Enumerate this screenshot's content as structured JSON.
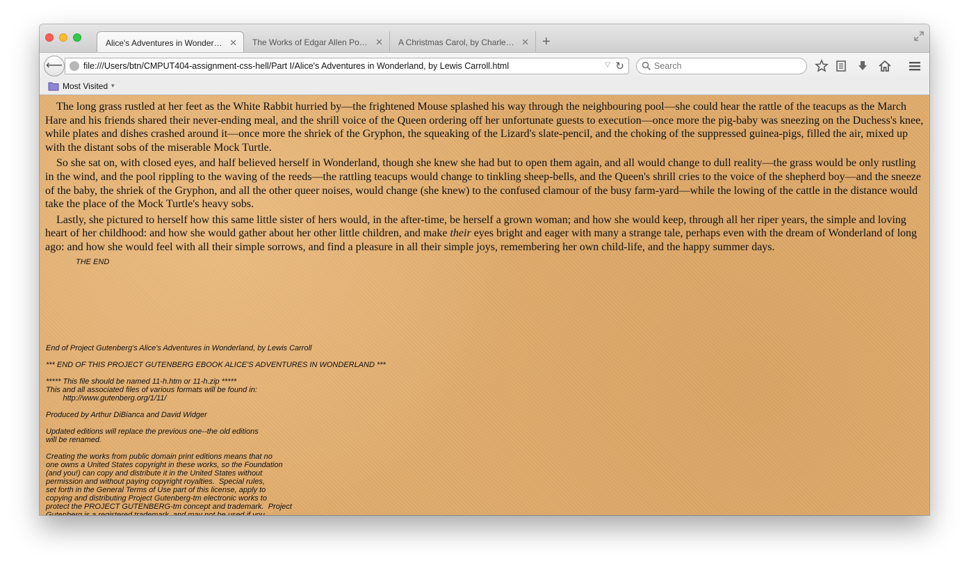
{
  "tabs": [
    {
      "title": "Alice's Adventures in Wonderl…",
      "active": true
    },
    {
      "title": "The Works of Edgar Allen Poe,…",
      "active": false
    },
    {
      "title": "A Christmas Carol, by Charles …",
      "active": false
    }
  ],
  "tab_close_glyph": "✕",
  "new_tab_glyph": "+",
  "navbar": {
    "back_glyph": "⟵",
    "url": "file:///Users/btn/CMPUT404-assignment-css-hell/Part I/Alice's Adventures in Wonderland, by Lewis Carroll.html",
    "dropdown_glyph": "▽",
    "reload_glyph": "↻",
    "search_placeholder": "Search"
  },
  "bookmarks": {
    "most_visited": "Most Visited",
    "arrow_glyph": "▾"
  },
  "content": {
    "paragraphs": [
      "The long grass rustled at her feet as the White Rabbit hurried by—the frightened Mouse splashed his way through the neighbouring pool—she could hear the rattle of the teacups as the March Hare and his friends shared their never-ending meal, and the shrill voice of the Queen ordering off her unfortunate guests to execution—once more the pig-baby was sneezing on the Duchess's knee, while plates and dishes crashed around it—once more the shriek of the Gryphon, the squeaking of the Lizard's slate-pencil, and the choking of the suppressed guinea-pigs, filled the air, mixed up with the distant sobs of the miserable Mock Turtle.",
      "So she sat on, with closed eyes, and half believed herself in Wonderland, though she knew she had but to open them again, and all would change to dull reality—the grass would be only rustling in the wind, and the pool rippling to the waving of the reeds—the rattling teacups would change to tinkling sheep-bells, and the Queen's shrill cries to the voice of the shepherd boy—and the sneeze of the baby, the shriek of the Gryphon, and all the other queer noises, would change (she knew) to the confused clamour of the busy farm-yard—while the lowing of the cattle in the distance would take the place of the Mock Turtle's heavy sobs."
    ],
    "p3_before": "Lastly, she pictured to herself how this same little sister of hers would, in the after-time, be herself a grown woman; and how she would keep, through all her riper years, the simple and loving heart of her childhood: and how she would gather about her other little children, and make ",
    "p3_italic": "their",
    "p3_after": " eyes bright and eager with many a strange tale, perhaps even with the dream of Wonderland of long ago: and how she would feel with all their simple sorrows, and find a pleasure in all their simple joys, remembering her own child-life, and the happy summer days.",
    "the_end": "THE END",
    "pg_lines": [
      "End of Project Gutenberg's Alice's Adventures in Wonderland, by Lewis Carroll",
      "",
      "*** END OF THIS PROJECT GUTENBERG EBOOK ALICE'S ADVENTURES IN WONDERLAND ***",
      "",
      "***** This file should be named 11-h.htm or 11-h.zip *****",
      "This and all associated files of various formats will be found in:",
      "        http://www.gutenberg.org/1/11/",
      "",
      "Produced by Arthur DiBianca and David Widger",
      "",
      "Updated editions will replace the previous one--the old editions",
      "will be renamed.",
      "",
      "Creating the works from public domain print editions means that no",
      "one owns a United States copyright in these works, so the Foundation",
      "(and you!) can copy and distribute it in the United States without",
      "permission and without paying copyright royalties.  Special rules,",
      "set forth in the General Terms of Use part of this license, apply to",
      "copying and distributing Project Gutenberg-tm electronic works to",
      "protect the PROJECT GUTENBERG-tm concept and trademark.  Project",
      "Gutenberg is a registered trademark, and may not be used if you"
    ]
  },
  "colors": {
    "page_background": "#e0ac6d",
    "close_red": "#fc5b57",
    "minimize_yellow": "#fdbc2e",
    "zoom_green": "#34c84a"
  },
  "icons": [
    "close-window-icon",
    "minimize-window-icon",
    "zoom-window-icon",
    "fullscreen-icon",
    "back-arrow-icon",
    "globe-icon",
    "reload-icon",
    "search-icon",
    "bookmark-star-icon",
    "reading-list-icon",
    "download-icon",
    "home-icon",
    "menu-icon",
    "bookmark-folder-icon"
  ]
}
